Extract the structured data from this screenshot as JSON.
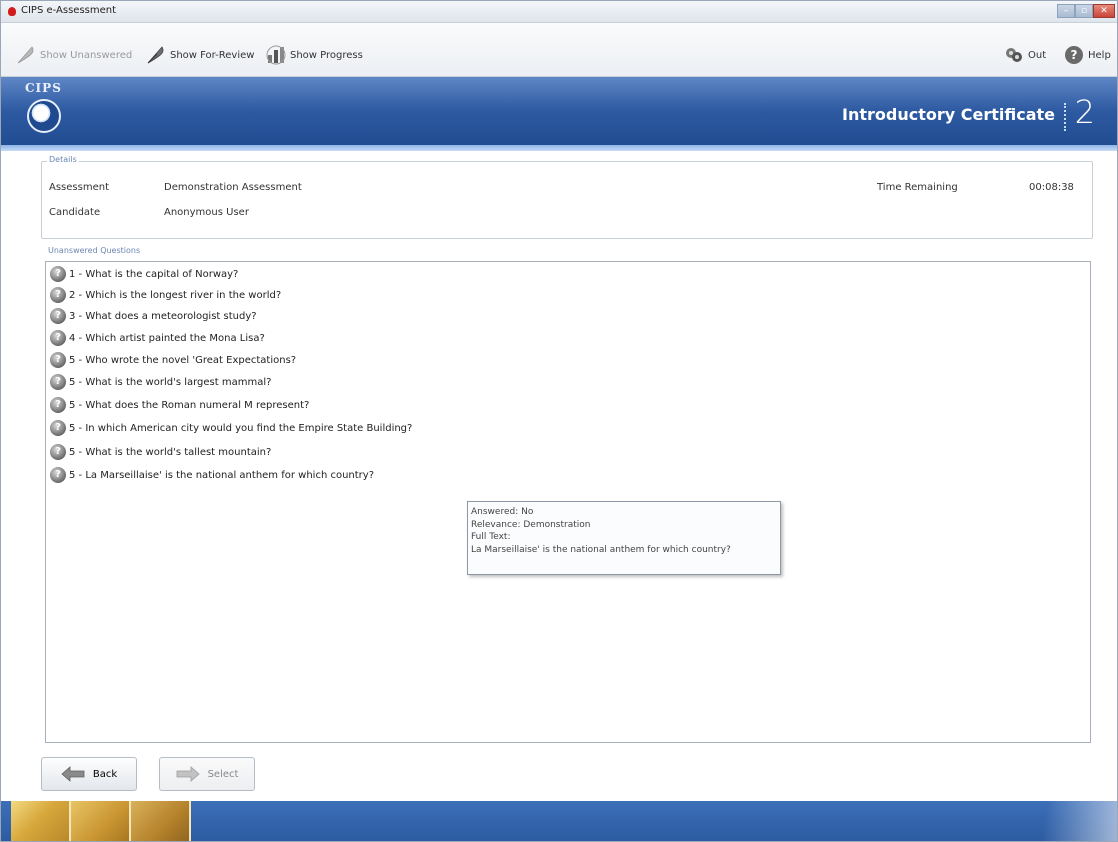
{
  "window": {
    "title": "CIPS e-Assessment",
    "controls": [
      "minimize",
      "maximize",
      "close"
    ]
  },
  "toolbar": {
    "show_unanswered": "Show Unanswered",
    "show_for_review": "Show For-Review",
    "show_progress": "Show Progress",
    "out": "Out",
    "help": "Help"
  },
  "banner": {
    "brand": "CIPS",
    "certificate_title": "Introductory Certificate",
    "certificate_number": "2"
  },
  "details": {
    "group_label": "Details",
    "assessment_label": "Assessment",
    "assessment_value": "Demonstration Assessment",
    "candidate_label": "Candidate",
    "candidate_value": "Anonymous User",
    "time_label": "Time Remaining",
    "time_value": "00:08:38"
  },
  "questions": {
    "group_label": "Unanswered Questions",
    "items": [
      "1 - What is the capital of Norway?",
      "2 - Which is the longest river in the world?",
      "3 - What does a meteorologist study?",
      "4 - Which artist painted the Mona Lisa?",
      "5 - Who wrote the novel 'Great Expectations?",
      "5 - What is the world's largest mammal?",
      "5 - What does the Roman numeral M represent?",
      "5 - In which American city would you find the Empire State Building?",
      "5 - What is the world's tallest mountain?",
      "5 - La Marseillaise' is the national anthem for which country?"
    ]
  },
  "tooltip": {
    "answered": "Answered: No",
    "relevance": "Relevance: Demonstration",
    "full_text_label": "Full Text:",
    "full_text": "La Marseillaise' is the national anthem for which country?"
  },
  "nav": {
    "back": "Back",
    "select": "Select"
  },
  "colors": {
    "banner": "#2e5aa2",
    "footer": "#2b5aa0",
    "accent_gold": "#d7a83c",
    "group_label": "#6b86b3"
  },
  "icons": {
    "show_unanswered": "feather-icon",
    "show_for_review": "feather-pen-icon",
    "show_progress": "progress-chart-icon",
    "out": "exit-gear-icon",
    "help": "help-question-icon",
    "question": "question-mark-icon",
    "back": "left-arrow-icon",
    "select": "right-arrow-icon"
  }
}
